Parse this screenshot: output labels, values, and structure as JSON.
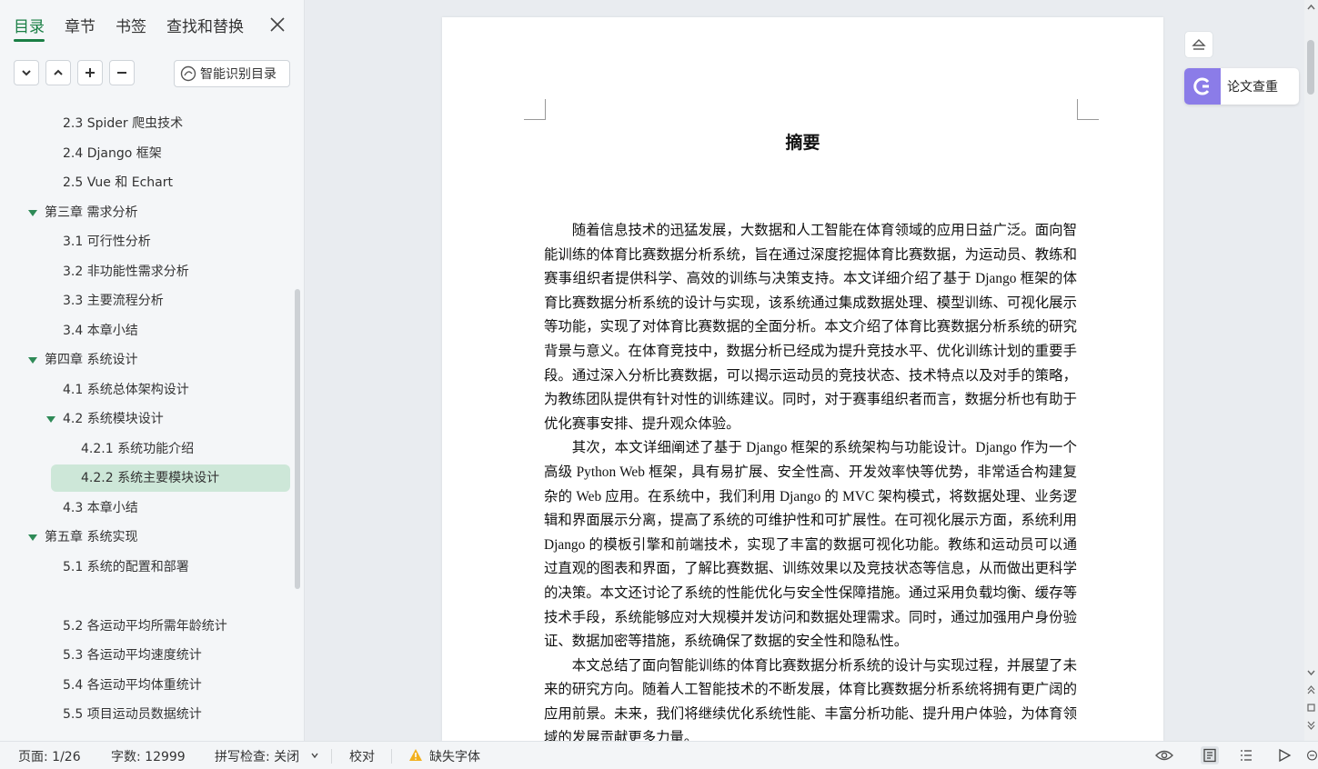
{
  "sidebar": {
    "tabs": [
      "目录",
      "章节",
      "书签",
      "查找和替换"
    ],
    "smart_button": "智能识别目录",
    "toc": [
      {
        "label": "2.3 Spider 爬虫技术",
        "level": 2
      },
      {
        "label": "2.4 Django 框架",
        "level": 2
      },
      {
        "label": "2.5 Vue 和 Echart",
        "level": 2
      },
      {
        "label": "第三章  需求分析",
        "level": 1,
        "expanded": true
      },
      {
        "label": "3.1 可行性分析",
        "level": 2
      },
      {
        "label": "3.2  非功能性需求分析",
        "level": 2
      },
      {
        "label": "3.3 主要流程分析",
        "level": 2
      },
      {
        "label": "3.4 本章小结",
        "level": 2
      },
      {
        "label": "第四章  系统设计",
        "level": 1,
        "expanded": true
      },
      {
        "label": "4.1  系统总体架构设计",
        "level": 2
      },
      {
        "label": "4.2  系统模块设计",
        "level": 2,
        "expanded": true
      },
      {
        "label": "4.2.1 系统功能介绍",
        "level": 3
      },
      {
        "label": "4.2.2 系统主要模块设计",
        "level": 3,
        "active": true
      },
      {
        "label": "4.3  本章小结",
        "level": 2
      },
      {
        "label": "第五章  系统实现",
        "level": 1,
        "expanded": true
      },
      {
        "label": "5.1  系统的配置和部署",
        "level": 2
      },
      {
        "label": "",
        "level": 2
      },
      {
        "label": "5.2  各运动平均所需年龄统计",
        "level": 2
      },
      {
        "label": "5.3  各运动平均速度统计",
        "level": 2
      },
      {
        "label": "5.4  各运动平均体重统计",
        "level": 2
      },
      {
        "label": "5.5  项目运动员数据统计",
        "level": 2
      }
    ]
  },
  "document": {
    "title": "摘要",
    "paragraphs": [
      "随着信息技术的迅猛发展，大数据和人工智能在体育领域的应用日益广泛。面向智能训练的体育比赛数据分析系统，旨在通过深度挖掘体育比赛数据，为运动员、教练和赛事组织者提供科学、高效的训练与决策支持。本文详细介绍了基于 Django 框架的体育比赛数据分析系统的设计与实现，该系统通过集成数据处理、模型训练、可视化展示等功能，实现了对体育比赛数据的全面分析。本文介绍了体育比赛数据分析系统的研究背景与意义。在体育竞技中，数据分析已经成为提升竞技水平、优化训练计划的重要手段。通过深入分析比赛数据，可以揭示运动员的竞技状态、技术特点以及对手的策略，为教练团队提供有针对性的训练建议。同时，对于赛事组织者而言，数据分析也有助于优化赛事安排、提升观众体验。",
      "其次，本文详细阐述了基于 Django 框架的系统架构与功能设计。Django 作为一个高级 Python Web 框架，具有易扩展、安全性高、开发效率快等优势，非常适合构建复杂的 Web 应用。在系统中，我们利用 Django 的 MVC 架构模式，将数据处理、业务逻辑和界面展示分离，提高了系统的可维护性和可扩展性。在可视化展示方面，系统利用 Django 的模板引擎和前端技术，实现了丰富的数据可视化功能。教练和运动员可以通过直观的图表和界面，了解比赛数据、训练效果以及竞技状态等信息，从而做出更科学的决策。本文还讨论了系统的性能优化与安全性保障措施。通过采用负载均衡、缓存等技术手段，系统能够应对大规模并发访问和数据处理需求。同时，通过加强用户身份验证、数据加密等措施，系统确保了数据的安全性和隐私性。",
      "本文总结了面向智能训练的体育比赛数据分析系统的设计与实现过程，并展望了未来的研究方向。随着人工智能技术的不断发展，体育比赛数据分析系统将拥有更广阔的应用前景。未来，我们将继续优化系统性能、丰富分析功能、提升用户体验，为体育领域的发展贡献更多力量。"
    ]
  },
  "right_panel": {
    "plagiarism_label": "论文查重"
  },
  "status": {
    "page": "页面: 1/26",
    "words": "字数: 12999",
    "spell": "拼写检查: 关闭",
    "proof": "校对",
    "missing_font": "缺失字体"
  },
  "colors": {
    "accent": "#1a7f45",
    "active_row": "#cde7d8",
    "plagiarism": "#8b7ce8"
  }
}
